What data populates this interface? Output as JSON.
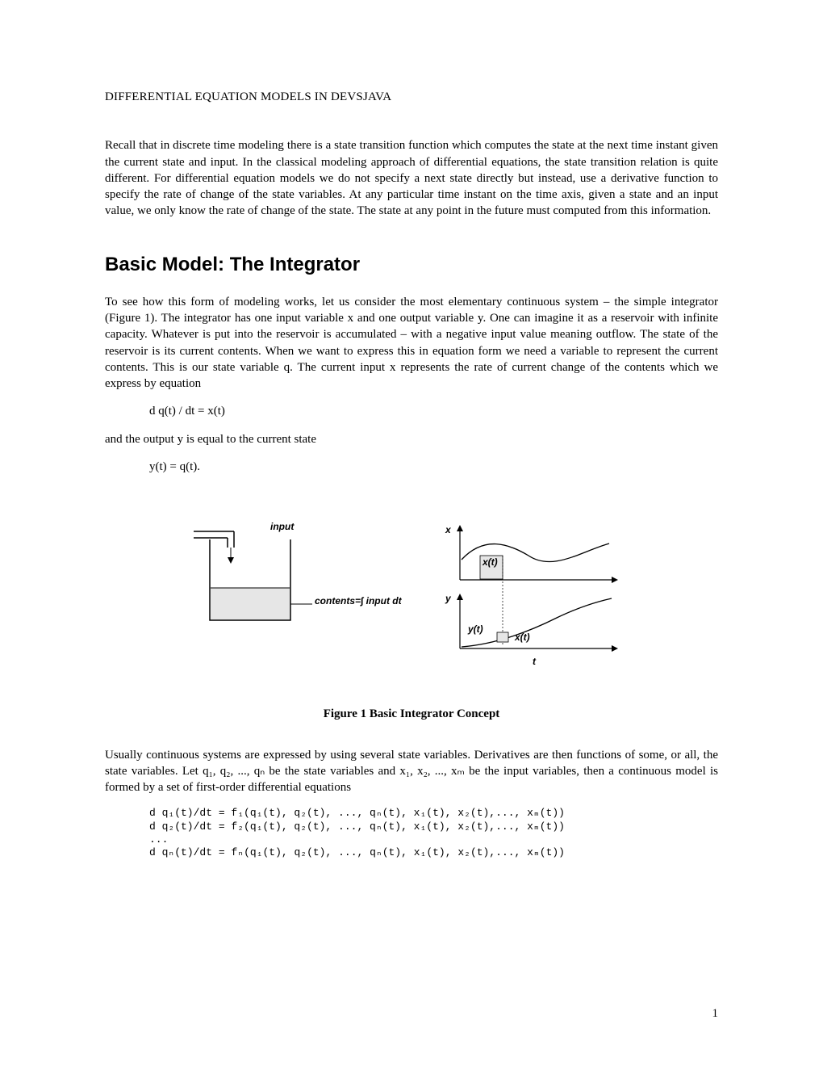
{
  "doc_title": "DIFFERENTIAL EQUATION MODELS IN DEVSJAVA",
  "intro_para": "Recall that in discrete time modeling there is a state transition function which computes the state at the next time instant given the current state and input.  In the classical modeling approach of differential equations, the state transition relation is quite different. For differential equation models we do not specify a next state directly but instead, use a derivative function to specify the rate of change of  the state variables.  At any particular time instant on the time axis, given a state and an input value, we only know the rate of change of the state. The state at any point in the future must computed from this information.",
  "section_heading": "Basic Model: The Integrator",
  "section_para": "To see how this form of modeling works, let us consider the most elementary continuous system – the simple integrator (Figure 1). The integrator has one input variable x and one output variable y. One can imagine it as a reservoir with infinite capacity. Whatever is put into the reservoir is accumulated – with a negative input value meaning outflow.  The state of the reservoir is its current contents. When we want to express this in equation form we need a variable to represent the current contents. This is our state variable q. The current input x represents the rate of current change of the contents which we express by equation",
  "eq1": "d q(t) / dt = x(t)",
  "bridge_text": "and the output y is equal to the current state",
  "eq2": "y(t) = q(t).",
  "fig": {
    "label_input": "input",
    "label_contents": "contents=∫ input dt",
    "axis_x": "x",
    "axis_y": "y",
    "axis_t": "t",
    "label_xt": "x(t)",
    "label_yt": "y(t)",
    "caption": "Figure 1 Basic Integrator Concept"
  },
  "usually_para": "Usually continuous systems are expressed by using several state variables.  Derivatives are then functions of some, or all, the state variables. Let q₁, q₂, ..., qₙ be the state variables and x₁, x₂, ..., xₘ be the input variables, then a continuous model is formed by a set of first-order differential equations",
  "eq_block": "d q₁(t)/dt = f₁(q₁(t), q₂(t), ..., qₙ(t), x₁(t), x₂(t),..., xₘ(t))\nd q₂(t)/dt = f₂(q₁(t), q₂(t), ..., qₙ(t), x₁(t), x₂(t),..., xₘ(t))\n...\nd qₙ(t)/dt = fₙ(q₁(t), q₂(t), ..., qₙ(t), x₁(t), x₂(t),..., xₘ(t))",
  "page_number": "1"
}
